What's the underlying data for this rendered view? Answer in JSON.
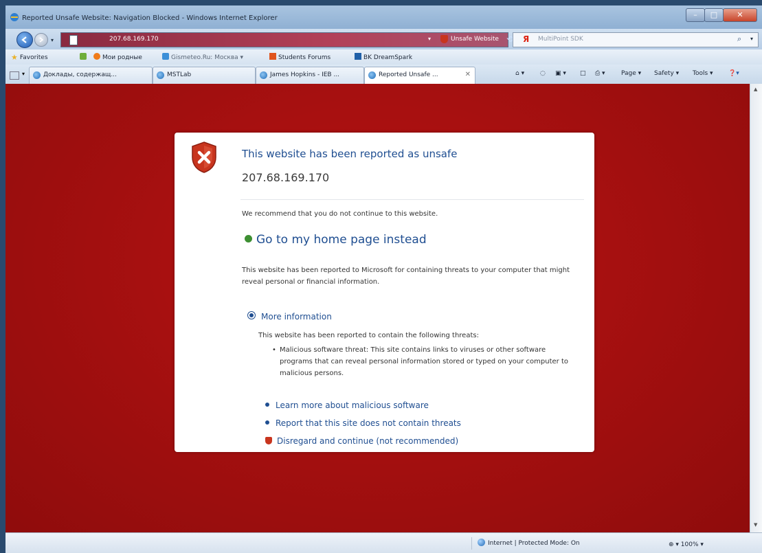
{
  "window": {
    "title": "Reported Unsafe Website: Navigation Blocked - Windows Internet Explorer",
    "min_label": "–",
    "max_label": "□",
    "close_label": "✕"
  },
  "address": {
    "url": "207.68.169.170",
    "status_badge": "Unsafe Website",
    "search_placeholder": "MultiPoint SDK"
  },
  "favorites": [
    {
      "label": "Favorites"
    },
    {
      "label": "Мои родные"
    },
    {
      "label": "Gismeteo.Ru: Москва"
    },
    {
      "label": "Students Forums"
    },
    {
      "label": "BK DreamSpark"
    }
  ],
  "tabs": [
    {
      "label": "Доклады, содержащ..."
    },
    {
      "label": "MSTLab"
    },
    {
      "label": "James Hopkins - IEB ..."
    },
    {
      "label": "Reported Unsafe ..."
    }
  ],
  "commands": {
    "page": "Page ▾",
    "safety": "Safety ▾",
    "tools": "Tools ▾"
  },
  "warning": {
    "headline": "This website has been reported as unsafe",
    "ip": "207.68.169.170",
    "recommend": "We recommend that you do not continue to this website.",
    "home_link": "Go to my home page instead",
    "reported_text": "This website has been reported to Microsoft for containing threats to your computer that might reveal personal or financial information.",
    "more_info": "More information",
    "threats_intro": "This website has been reported to contain the following threats:",
    "threat_detail": "Malicious software threat: This site contains links to viruses or other software programs that can reveal personal information stored or typed on your computer to malicious persons.",
    "learn_more": "Learn more about malicious software",
    "report_link": "Report that this site does not contain threats",
    "disregard": "Disregard and continue (not recommended)"
  },
  "status": {
    "zone": "Internet | Protected Mode: On",
    "zoom": "100%"
  },
  "colors": {
    "page_background": "#a81010",
    "link": "#1f4e91",
    "danger": "#c8351e"
  }
}
